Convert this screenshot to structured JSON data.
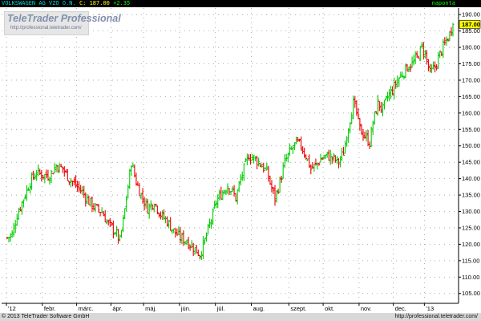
{
  "header": {
    "symbol": "VOLKSWAGEN AG VZO O.N.",
    "last": "C: 187.00",
    "change": "+2.35",
    "period": "naponta"
  },
  "watermark": {
    "brand": "TeleTrader Professional",
    "url": "http://professional.teletrader.com/"
  },
  "footer": {
    "copyright": "© 2013 TeleTrader Software GmbH",
    "url": "http://professional.teletrader.com/"
  },
  "colors": {
    "up": "#00cc00",
    "down": "#ee0000",
    "last_badge": "#ffff00",
    "axis_text": "#000000",
    "grid_dots": "#9a9a9a"
  },
  "chart_data": {
    "type": "bar",
    "style": "ohlc",
    "title": "VOLKSWAGEN AG VZO O.N.",
    "interval": "naponta",
    "last_price": 187.0,
    "last_label": "187.00",
    "ylim": [
      102,
      192
    ],
    "y_ticks": [
      105,
      110,
      115,
      120,
      125,
      130,
      135,
      140,
      145,
      150,
      155,
      160,
      165,
      170,
      175,
      180,
      185,
      190
    ],
    "y_tick_labels": [
      "105.00",
      "110.00",
      "115.00",
      "120.00",
      "125.00",
      "130.00",
      "135.00",
      "140.00",
      "145.00",
      "150.00",
      "155.00",
      "160.00",
      "165.00",
      "170.00",
      "175.00",
      "180.00",
      "185.00",
      "190.00"
    ],
    "x_labels": [
      "'12",
      "febr.",
      "márc.",
      "ápr.",
      "máj.",
      "jún.",
      "júl.",
      "aug.",
      "szept.",
      "okt.",
      "nov.",
      "dec.",
      "'13"
    ],
    "x_label_day_index": [
      0,
      22,
      43,
      64,
      84,
      106,
      128,
      150,
      173,
      194,
      216,
      237,
      256
    ],
    "grid": true,
    "price_path": [
      [
        0,
        122
      ],
      [
        3,
        123
      ],
      [
        6,
        129
      ],
      [
        10,
        134
      ],
      [
        14,
        139
      ],
      [
        18,
        142
      ],
      [
        22,
        141
      ],
      [
        26,
        141
      ],
      [
        30,
        144
      ],
      [
        34,
        143
      ],
      [
        38,
        140
      ],
      [
        42,
        138
      ],
      [
        46,
        136
      ],
      [
        50,
        133
      ],
      [
        54,
        131
      ],
      [
        58,
        130
      ],
      [
        62,
        126
      ],
      [
        66,
        124
      ],
      [
        69,
        121
      ],
      [
        71,
        127
      ],
      [
        73,
        134
      ],
      [
        76,
        145
      ],
      [
        79,
        139
      ],
      [
        82,
        135
      ],
      [
        86,
        131
      ],
      [
        90,
        133
      ],
      [
        94,
        129
      ],
      [
        98,
        127
      ],
      [
        102,
        124
      ],
      [
        106,
        122
      ],
      [
        110,
        121
      ],
      [
        114,
        119
      ],
      [
        118,
        117
      ],
      [
        121,
        121
      ],
      [
        124,
        126
      ],
      [
        126,
        129
      ],
      [
        128,
        133
      ],
      [
        132,
        136
      ],
      [
        135,
        138
      ],
      [
        138,
        136
      ],
      [
        140,
        134
      ],
      [
        142,
        138
      ],
      [
        145,
        143
      ],
      [
        148,
        147
      ],
      [
        152,
        146
      ],
      [
        156,
        144
      ],
      [
        159,
        142
      ],
      [
        162,
        137
      ],
      [
        164,
        134
      ],
      [
        167,
        139
      ],
      [
        170,
        145
      ],
      [
        173,
        148
      ],
      [
        177,
        151
      ],
      [
        180,
        150
      ],
      [
        183,
        147
      ],
      [
        186,
        143
      ],
      [
        189,
        144
      ],
      [
        192,
        146
      ],
      [
        196,
        147
      ],
      [
        200,
        146
      ],
      [
        203,
        145
      ],
      [
        206,
        148
      ],
      [
        209,
        156
      ],
      [
        212,
        163
      ],
      [
        214,
        160
      ],
      [
        216,
        155
      ],
      [
        219,
        153
      ],
      [
        222,
        151
      ],
      [
        224,
        157
      ],
      [
        227,
        163
      ],
      [
        230,
        161
      ],
      [
        233,
        165
      ],
      [
        236,
        167
      ],
      [
        239,
        170
      ],
      [
        242,
        172
      ],
      [
        245,
        174
      ],
      [
        248,
        175
      ],
      [
        251,
        177
      ],
      [
        254,
        180
      ],
      [
        256,
        178
      ],
      [
        259,
        172
      ],
      [
        262,
        174
      ],
      [
        265,
        178
      ],
      [
        268,
        181
      ],
      [
        271,
        184
      ],
      [
        273,
        187
      ]
    ]
  }
}
